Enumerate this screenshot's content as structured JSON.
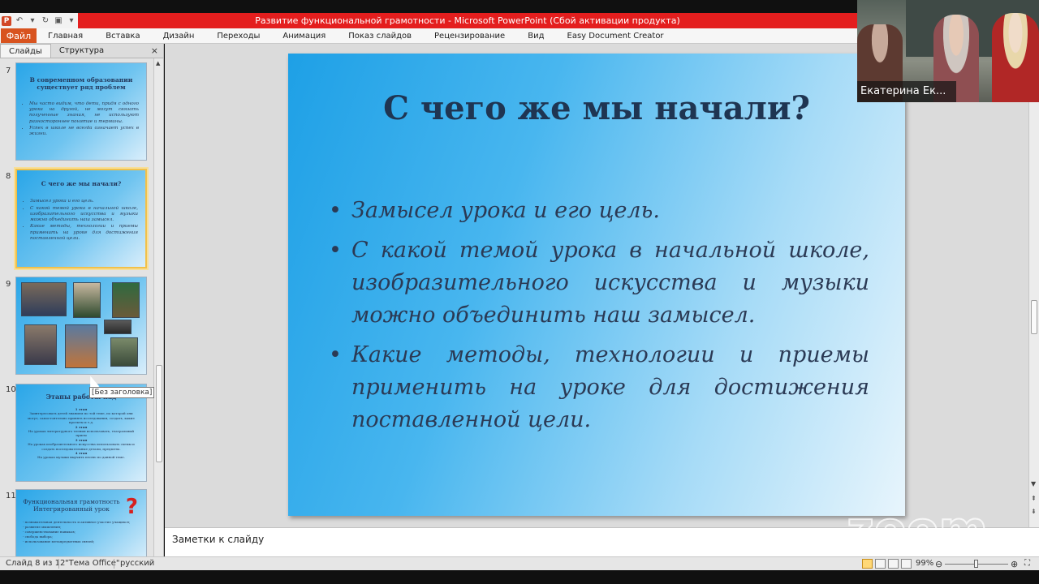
{
  "window": {
    "title": "Развитие функциональной грамотности  -  Microsoft PowerPoint (Сбой активации продукта)"
  },
  "ribbon": {
    "file_tab": "Файл",
    "tabs": [
      "Главная",
      "Вставка",
      "Дизайн",
      "Переходы",
      "Анимация",
      "Показ слайдов",
      "Рецензирование",
      "Вид",
      "Easy Document Creator"
    ]
  },
  "left_pane": {
    "tabs": [
      "Слайды",
      "Структура"
    ],
    "close_label": "×",
    "tooltip": "[Без заголовка]",
    "thumbnails": [
      {
        "number": "7",
        "title": "В современном образовании существует ряд проблем",
        "bullets": [
          "Мы часто видим, что дети, придя с одного урока на другой, не могут связать полученные знания, не используют разностороннее понятие и термины.",
          "Успех в школе не всегда означает успех в жизни."
        ]
      },
      {
        "number": "8",
        "title": "С чего же мы начали?",
        "bullets": [
          "Замысел урока и его цель.",
          "С какой темой урока в начальной школе, изобразительного искусства и музыки можно объединить наш замысел.",
          "Какие методы, технологии и приемы применить на уроке для достижения поставленной цели."
        ]
      },
      {
        "number": "9"
      },
      {
        "number": "10",
        "title": "Этапы работы над",
        "text": [
          "1 этап",
          "Заинтересовать детей знанием по той теме, по которой они могут, самостоятельно принять исследования, создать, какие проекты и т.д.",
          "2 этап",
          "На уроках литературного чтения использовать, театральный прием",
          "3 этап",
          "На уроках изобразительного искусства использовать схемы и создать последовательные детали, предметы.",
          "4 этап",
          "На уроках музыки выучить песню по данной теме."
        ]
      },
      {
        "number": "11",
        "title": "Функциональная грамотность Интегрированный урок",
        "text": [
          "- познавательная деятельность и активное участие учащихся;",
          "- развитие мышления;",
          "- совершенствование навыков;",
          "- свобода выбора;",
          "- использование метапредметных связей;"
        ]
      }
    ]
  },
  "slide": {
    "title": "С чего же мы начали?",
    "bullets": [
      "Замысел урока и его цель.",
      "С какой темой урока в начальной школе, изобразительного искусства и музыки можно объединить наш замысел.",
      "Какие методы, технологии и приемы применить на уроке для достижения поставленной цели."
    ]
  },
  "notes": {
    "placeholder": "Заметки к слайду"
  },
  "status_bar": {
    "slide_position": "Слайд 8 из 12",
    "theme": "\"Тема Office\"",
    "language": "русский",
    "zoom": "99%"
  },
  "video": {
    "participant_name": "Екатерина Ек..."
  },
  "watermark": {
    "text": "zoom"
  },
  "colors": {
    "title_bar": "#e41e1e",
    "file_tab": "#d8531f",
    "slide_title": "#1f3552",
    "selected_thumb": "#f2c14a"
  },
  "icons": [
    "powerpoint-logo-icon",
    "undo-icon",
    "redo-icon",
    "save-icon",
    "close-icon"
  ]
}
